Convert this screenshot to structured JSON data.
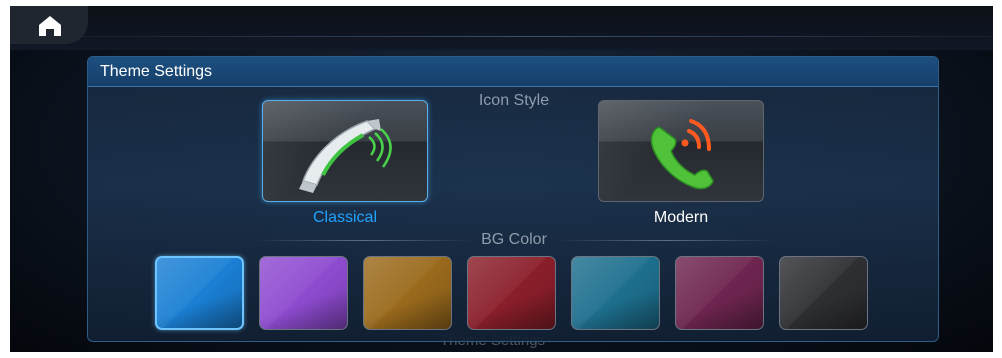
{
  "header": {
    "home_icon": "home-icon"
  },
  "panel": {
    "title": "Theme Settings",
    "icon_style": {
      "label": "Icon Style",
      "options": [
        {
          "label": "Classical",
          "icon": "classic-phone-icon",
          "selected": true
        },
        {
          "label": "Modern",
          "icon": "modern-phone-icon",
          "selected": false
        }
      ]
    },
    "bg_color": {
      "label": "BG Color",
      "swatches": [
        {
          "color": "#1a7fd4",
          "selected": true
        },
        {
          "color": "#8e4bd0",
          "selected": false
        },
        {
          "color": "#9a6a1c",
          "selected": false
        },
        {
          "color": "#8a1e2a",
          "selected": false
        },
        {
          "color": "#1d6f8e",
          "selected": false
        },
        {
          "color": "#6e2550",
          "selected": false
        },
        {
          "color": "#2e2f33",
          "selected": false
        }
      ]
    }
  },
  "background": {
    "ghost_label": "Theme Settings"
  },
  "colors": {
    "selected_text": "#1fa3ff",
    "text": "#ffffff",
    "accent": "#3a74a8"
  }
}
